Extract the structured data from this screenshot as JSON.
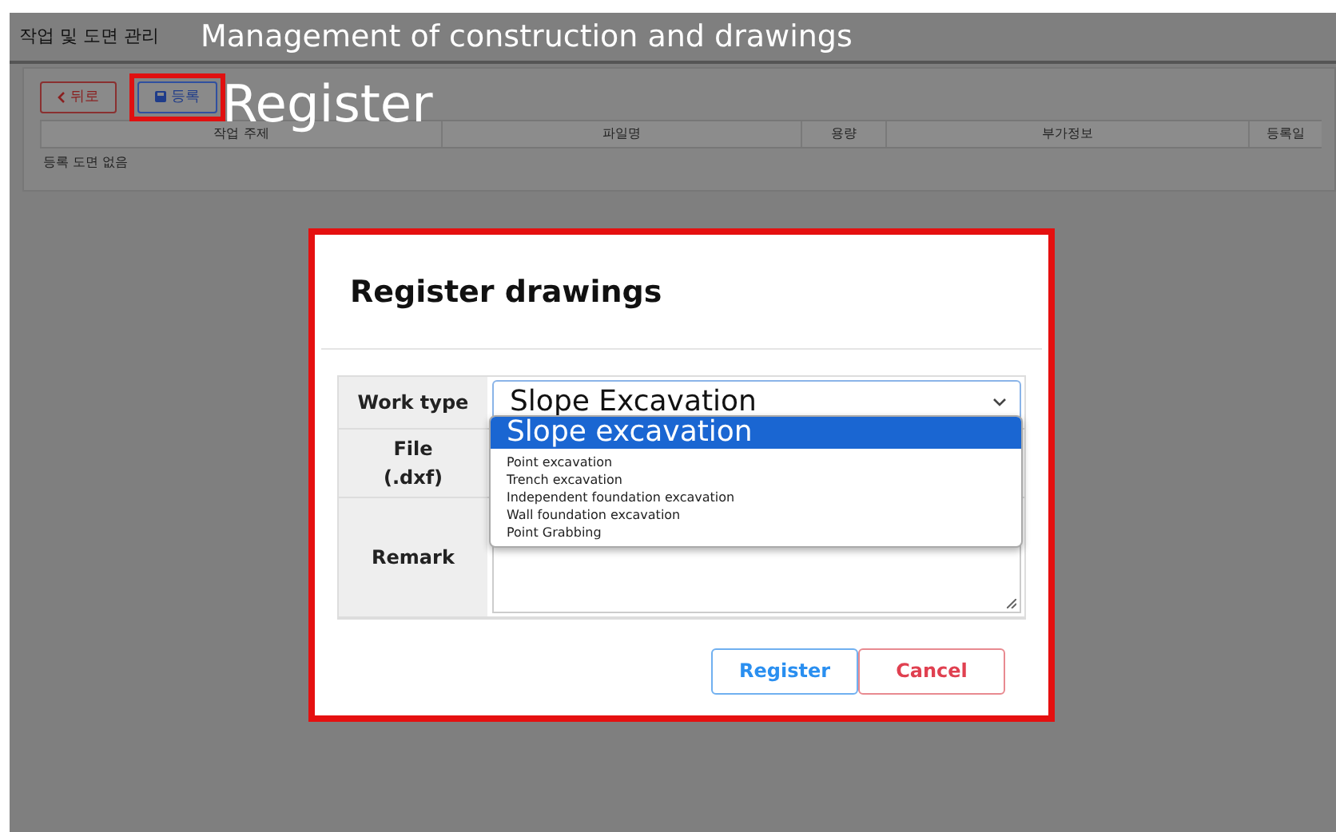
{
  "page": {
    "title": "작업 및 도면 관리",
    "back_button": {
      "label": "뒤로"
    },
    "register_button": {
      "label": "등록",
      "highlight": true
    },
    "table": {
      "columns": [
        "작업 주제",
        "파일명",
        "용량",
        "부가정보",
        "등록일"
      ],
      "empty_message": "등록 도면 없음"
    }
  },
  "captions": {
    "title_caption": "Management of construction and drawings",
    "button_caption": "Register"
  },
  "modal": {
    "title": "Register drawings",
    "highlight": true,
    "fields": [
      {
        "kind": "select",
        "label": "Work type",
        "value": "Slope Excavation",
        "options": [
          {
            "label": "Slope excavation",
            "selected": true
          },
          {
            "label": "Point excavation",
            "selected": false
          },
          {
            "label": "Trench excavation",
            "selected": false
          },
          {
            "label": "Independent foundation excavation",
            "selected": false
          },
          {
            "label": "Wall foundation excavation",
            "selected": false
          },
          {
            "label": "Point Grabbing",
            "selected": false
          }
        ]
      },
      {
        "kind": "file",
        "label": "File\n(.dxf)"
      },
      {
        "kind": "textarea",
        "label": "Remark"
      }
    ],
    "buttons": [
      {
        "kind": "primary",
        "label": "Register"
      },
      {
        "kind": "danger",
        "label": "Cancel"
      }
    ]
  }
}
